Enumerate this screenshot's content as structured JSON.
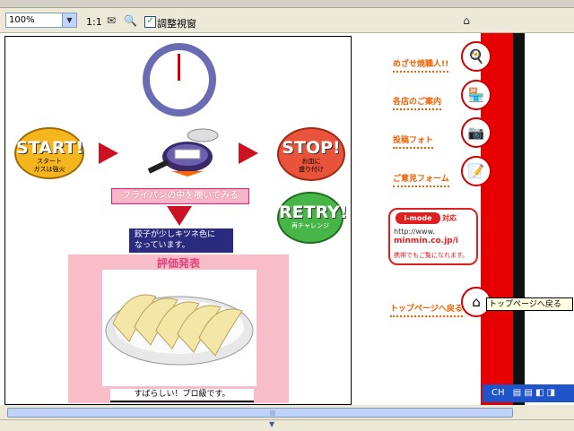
{
  "toolbar": {
    "zoom": "100%",
    "ratio": "1:1",
    "adjust_label": "調整視窗",
    "adjust_checked": true
  },
  "left": {
    "start": {
      "title": "START!",
      "sub": "スタート\nガスは強火"
    },
    "stop": {
      "title": "STOP!",
      "sub": "お皿に\n盛り付け"
    },
    "retry": {
      "title": "RETRY!",
      "sub": "再チャレンジ"
    },
    "peek_button": "フライパンの中を覗いてみる",
    "status": "餃子が少しキツネ色に\nなっています。",
    "evaluation_title": "評価発表",
    "result": "すばらしい！プロ級です。"
  },
  "right": {
    "links": [
      {
        "label": "めざせ焼職人!!",
        "icon": "pan-icon"
      },
      {
        "label": "各店のご案内",
        "icon": "shop-icon"
      },
      {
        "label": "投稿フォト",
        "icon": "camera-icon"
      },
      {
        "label": "ご意見フォーム",
        "icon": "form-icon"
      }
    ],
    "imode": {
      "badge": "i-mode",
      "badge_suffix": "対応",
      "url_prefix": "http://www.",
      "url_main": "minmin.co.jp/i",
      "note": "携帯でもご覧になれます。"
    },
    "top_link": "トップページへ戻る",
    "tooltip": "トップページへ戻る"
  },
  "taskbar": {
    "lang": "CH"
  },
  "colors": {
    "accent_red": "#e60000",
    "link_orange": "#f06000",
    "panel_pink": "#f9bcc9",
    "dark_navy": "#2a2a7e"
  }
}
